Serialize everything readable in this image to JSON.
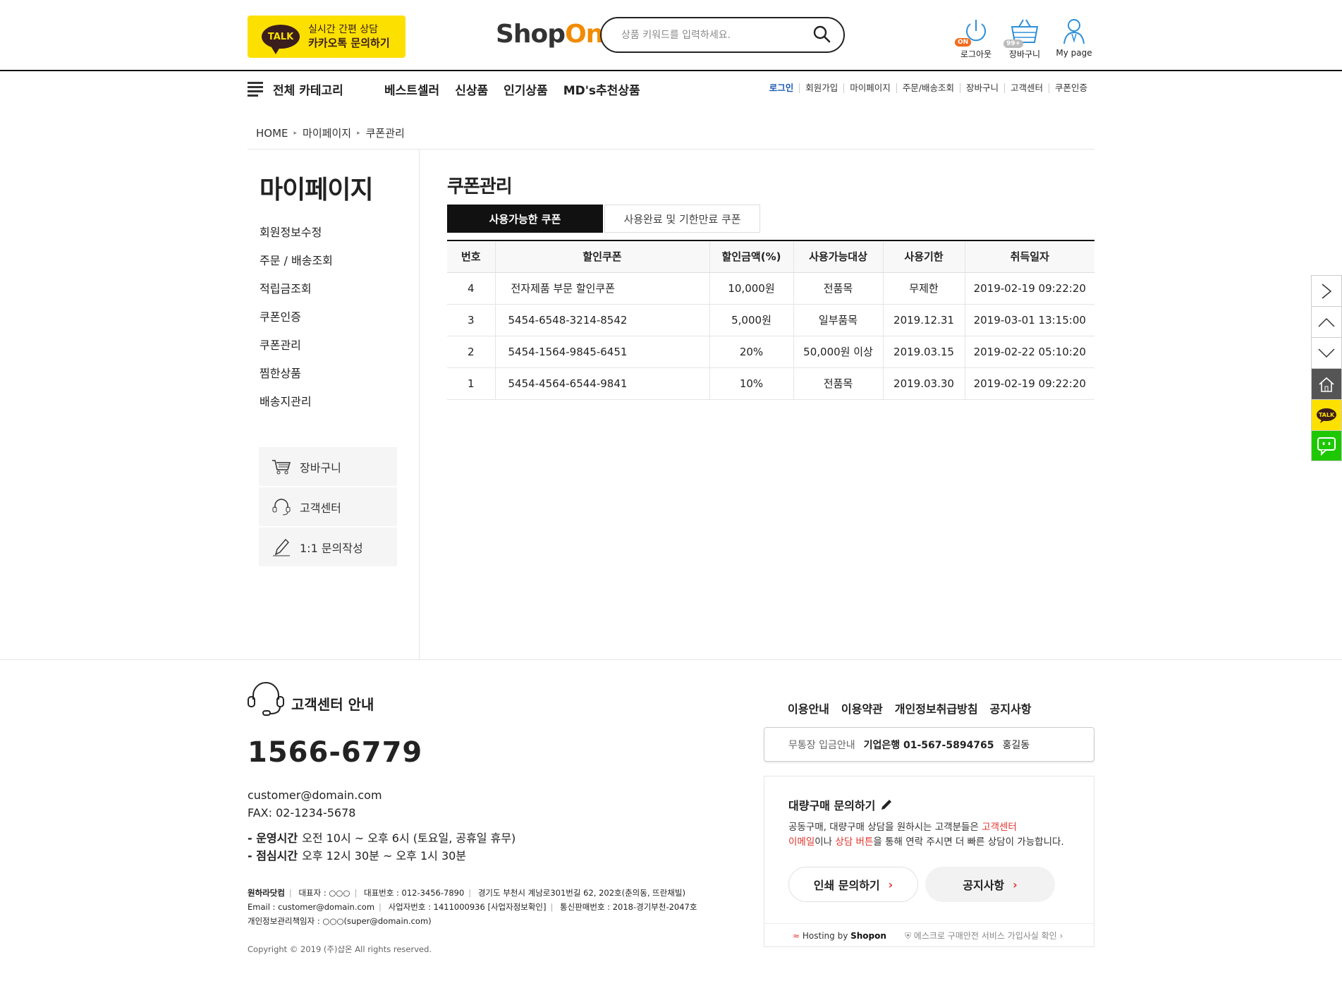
{
  "header": {
    "kakao_line1": "실시간 간편 상담",
    "kakao_line2": "카카오톡 문의하기",
    "kakao_badge": "TALK",
    "logo_main": "Shop",
    "logo_accent": "On",
    "search_placeholder": "상품 키워드를 입력하세요.",
    "icons": [
      {
        "label": "로그아웃",
        "badge": "ON",
        "icon": "power-icon"
      },
      {
        "label": "장바구니",
        "badge": "99+",
        "icon": "basket-icon"
      },
      {
        "label": "My page",
        "icon": "user-icon"
      }
    ]
  },
  "nav": {
    "all_categories": "전체 카테고리",
    "menus": [
      "베스트셀러",
      "신상품",
      "인기상품",
      "MD's추천상품"
    ],
    "util_links": [
      "로그인",
      "회원가입",
      "마이페이지",
      "주문/배송조회",
      "장바구니",
      "고객센터",
      "쿠폰인증"
    ]
  },
  "breadcrumb": [
    "HOME",
    "마이페이지",
    "쿠폰관리"
  ],
  "sidebar": {
    "title": "마이페이지",
    "items": [
      "회원정보수정",
      "주문 / 배송조회",
      "적립금조회",
      "쿠폰인증",
      "쿠폰관리",
      "찜한상품",
      "배송지관리"
    ],
    "quick": [
      {
        "label": "장바구니",
        "icon": "cart-icon"
      },
      {
        "label": "고객센터",
        "icon": "headset-icon"
      },
      {
        "label": "1:1 문의작성",
        "icon": "pen-icon"
      }
    ]
  },
  "main": {
    "title": "쿠폰관리",
    "tabs": [
      "사용가능한 쿠폰",
      "사용완료 및 기한만료 쿠폰"
    ],
    "columns": [
      "번호",
      "할인쿠폰",
      "할인금액(%)",
      "사용가능대상",
      "사용기한",
      "취득일자"
    ],
    "rows": [
      [
        "4",
        "전자제품 부문 할인쿠폰",
        "10,000원",
        "전품목",
        "무제한",
        "2019-02-19 09:22:20"
      ],
      [
        "3",
        "5454-6548-3214-8542",
        "5,000원",
        "일부품목",
        "2019.12.31",
        "2019-03-01 13:15:00"
      ],
      [
        "2",
        "5454-1564-9845-6451",
        "20%",
        "50,000원 이상",
        "2019.03.15",
        "2019-02-22 05:10:20"
      ],
      [
        "1",
        "5454-4564-6544-9841",
        "10%",
        "전품목",
        "2019.03.30",
        "2019-02-19 09:22:20"
      ]
    ]
  },
  "floating": [
    "chevron-right-icon",
    "chevron-up-icon",
    "chevron-down-icon",
    "home-icon",
    "kakao-talk-icon",
    "chat-icon"
  ],
  "footer": {
    "cs_title": "고객센터 안내",
    "phone": "1566-6779",
    "email": "customer@domain.com",
    "fax": "FAX: 02-1234-5678",
    "hours_label": "- 운영시간",
    "hours_value": "오전 10시 ~ 오후 6시 (토요일, 공휴일 휴무)",
    "lunch_label": "- 점심시간",
    "lunch_value": "오후 12시 30분 ~ 오후 1시 30분",
    "company_line1": [
      "원하라닷컴",
      "대표자 : ○○○",
      "대표번호 : 012-3456-7890",
      "경기도 부천시 계남로301번길 62, 202호(춘의동, 뜨란채빌)"
    ],
    "company_line2": [
      "Email : customer@domain.com",
      "사업자번호 : 1411000936 [사업자정보확인]",
      "통신판매번호 : 2018-경기부천-2047호"
    ],
    "company_line3": "개인정보관리책임자 : ○○○(super@domain.com)",
    "copyright": "Copyright © 2019 (주)샵온 All rights reserved.",
    "links": [
      "이용안내",
      "이용약관",
      "개인정보취급방침",
      "공지사항"
    ],
    "bank_label": "무통장 입금안내",
    "bank_account": "기업은행 01-567-5894765",
    "bank_holder": "홍길동",
    "bulk_title": "대량구매 문의하기",
    "bulk_text_1": "공동구매, 대량구매 상담을 원하시는 고객분들은 ",
    "bulk_red_1": "고객센터",
    "bulk_red_2": "이메일",
    "bulk_text_2": "이나 ",
    "bulk_red_3": "상담 버튼",
    "bulk_text_3": "을 통해 연락 주시면 더 빠른 상담이 가능합니다.",
    "btn_print": "인쇄 문의하기",
    "btn_notice": "공지사항",
    "hosting_prefix": "Hosting by ",
    "hosting_brand": "Shopon",
    "escrow": "에스크로 구매안전 서비스 가입사실 확인 ›"
  },
  "colors": {
    "kakao": "#fce000",
    "accent": "#f28b00",
    "link_active": "#1a5ab8",
    "red": "#e0342c",
    "naver_green": "#1ec800"
  }
}
